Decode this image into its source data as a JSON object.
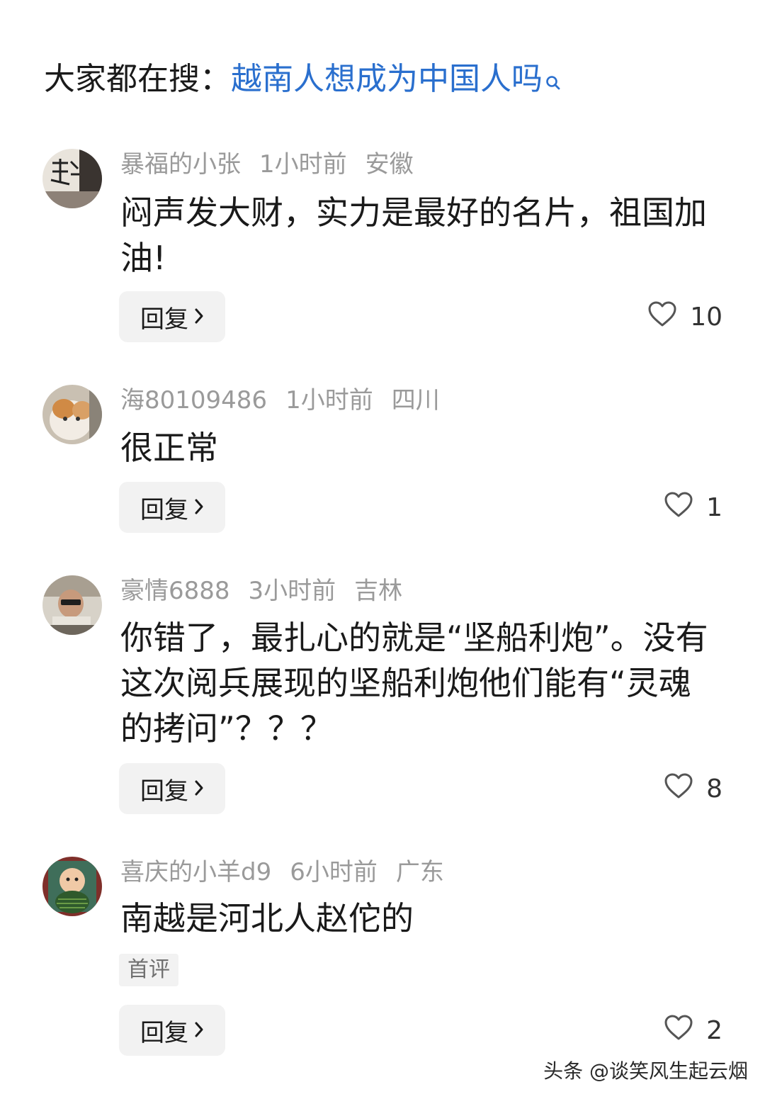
{
  "search": {
    "prefix": "大家都在搜：",
    "query": "越南人想成为中国人吗",
    "link_color": "#2a6fce"
  },
  "comments": [
    {
      "username": "暴福的小张",
      "time": "1小时前",
      "location": "安徽",
      "text": "闷声发大财，实力是最好的名片，祖国加油!",
      "reply_label": "回复",
      "likes": "10"
    },
    {
      "username": "海80109486",
      "time": "1小时前",
      "location": "四川",
      "text": "很正常",
      "reply_label": "回复",
      "likes": "1"
    },
    {
      "username": "豪情6888",
      "time": "3小时前",
      "location": "吉林",
      "text": "你错了，最扎心的就是“坚船利炮”。没有这次阅兵展现的坚船利炮他们能有“灵魂的拷问”？？？",
      "reply_label": "回复",
      "likes": "8"
    },
    {
      "username": "喜庆的小羊d9",
      "time": "6小时前",
      "location": "广东",
      "text": "南越是河北人赵佗的",
      "badge": "首评",
      "reply_label": "回复",
      "likes": "2"
    }
  ],
  "watermark": "头条 @谈笑风生起云烟"
}
